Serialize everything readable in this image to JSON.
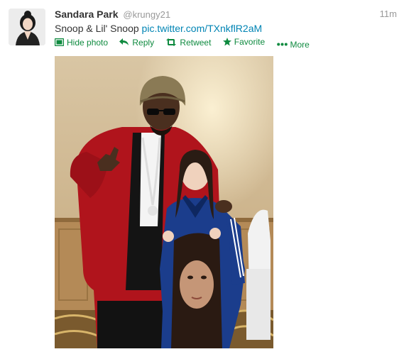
{
  "tweet": {
    "fullname": "Sandara Park",
    "username": "@krungy21",
    "time": "11m",
    "text": "Snoop & Lil' Snoop",
    "link": "pic.twitter.com/TXnkflR2aM"
  },
  "actions": {
    "hide_photo": "Hide photo",
    "reply": "Reply",
    "retweet": "Retweet",
    "favorite": "Favorite",
    "more": "More"
  },
  "icons": {
    "photo": "photo-icon",
    "reply": "reply-arrow-icon",
    "retweet": "retweet-icon",
    "favorite": "star-icon",
    "more": "ellipsis-icon"
  },
  "colors": {
    "action_green": "#0e8a3f",
    "link_blue": "#0084b4",
    "muted_gray": "#999999"
  }
}
